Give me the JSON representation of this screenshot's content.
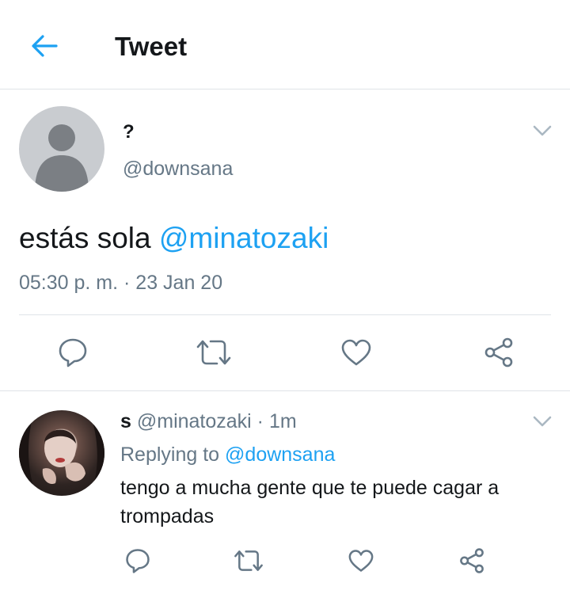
{
  "header": {
    "title": "Tweet"
  },
  "main_tweet": {
    "display_name": "?",
    "handle": "@downsana",
    "text": "estás sola ",
    "mention": "@minatozaki",
    "timestamp": "05:30 p. m. · 23 Jan 20"
  },
  "reply": {
    "display_name": "s",
    "handle": "@minatozaki",
    "separator": " · ",
    "time_ago": "1m",
    "replying_prefix": "Replying to ",
    "replying_handle": "@downsana",
    "text": "tengo a mucha gente que te puede cagar a trompadas"
  },
  "colors": {
    "accent": "#1da1f2",
    "secondary_text": "#657786",
    "divider": "#dfe3e8"
  },
  "icons": [
    "back-arrow-icon",
    "chevron-down-icon",
    "reply-icon",
    "retweet-icon",
    "like-icon",
    "share-icon"
  ]
}
